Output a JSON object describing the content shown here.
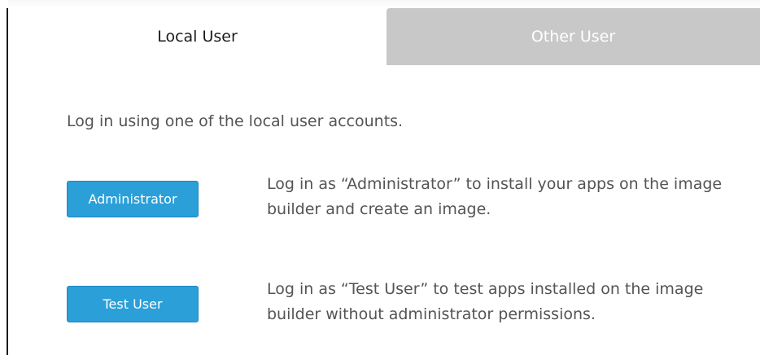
{
  "tabs": [
    {
      "label": "Local User",
      "active": true
    },
    {
      "label": "Other User",
      "active": false
    }
  ],
  "intro_text": "Log in using one of the local user accounts.",
  "accounts": [
    {
      "button_label": "Administrator",
      "description": "Log in as “Administrator” to install your apps on the image builder and create an image."
    },
    {
      "button_label": "Test User",
      "description": "Log in as “Test User” to test apps installed on the image builder without administrator permissions."
    }
  ],
  "colors": {
    "button": "#2b9fd8",
    "inactive_tab": "#c8c8c8",
    "text": "#545454"
  }
}
